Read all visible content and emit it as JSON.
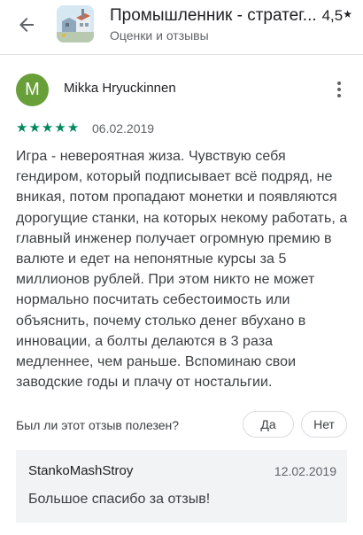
{
  "header": {
    "app_title": "Промышленник - стратег...",
    "subtitle": "Оценки и отзывы",
    "rating": "4,5",
    "rating_icon": "star-icon",
    "back_icon": "arrow-back-icon"
  },
  "review": {
    "avatar_letter": "M",
    "avatar_color": "#689f38",
    "author": "Mikka Hryuckinnen",
    "stars": 5,
    "star_color": "#01875f",
    "date": "06.02.2019",
    "text": "Игра - невероятная жиза. Чувствую себя гендиром, который подписывает всё подряд, не вникая, потом пропадают монетки и появляются дорогущие станки, на которых некому работать, а главный инженер получает огромную премию в валюте и едет на непонятные курсы за 5 миллионов рублей. При этом никто не может нормально посчитать себестоимость или объяснить, почему столько денег вбухано в инновации, а болты делаются в 3 раза медленнее, чем раньше. Вспоминаю свои заводские годы и плачу от ностальгии."
  },
  "feedback": {
    "question": "Был ли этот отзыв полезен?",
    "yes_label": "Да",
    "no_label": "Нет"
  },
  "reply": {
    "author": "StankoMashStroy",
    "date": "12.02.2019",
    "text": "Большое спасибо за отзыв!"
  }
}
